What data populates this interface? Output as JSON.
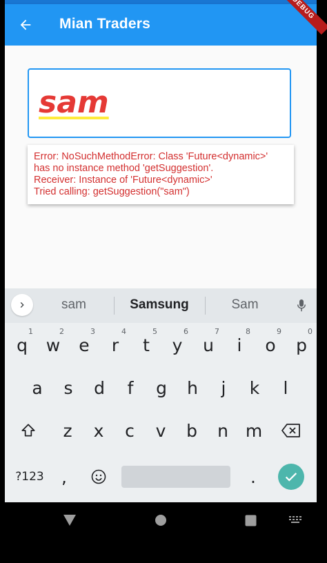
{
  "appbar": {
    "title": "Mian Traders",
    "debug_label": "DEBUG",
    "color": "#2196F3"
  },
  "input": {
    "value": "sam",
    "text_color": "#E53935"
  },
  "error": {
    "lines": [
      "Error: NoSuchMethodError: Class 'Future<dynamic>'",
      "has no instance method 'getSuggestion'.",
      "Receiver: Instance of 'Future<dynamic>'",
      "Tried calling: getSuggestion(\"sam\")"
    ],
    "color": "#D32F2F"
  },
  "keyboard": {
    "suggestions": [
      "sam",
      "Samsung",
      "Sam"
    ],
    "row1": [
      {
        "k": "q",
        "h": "1"
      },
      {
        "k": "w",
        "h": "2"
      },
      {
        "k": "e",
        "h": "3"
      },
      {
        "k": "r",
        "h": "4"
      },
      {
        "k": "t",
        "h": "5"
      },
      {
        "k": "y",
        "h": "6"
      },
      {
        "k": "u",
        "h": "7"
      },
      {
        "k": "i",
        "h": "8"
      },
      {
        "k": "o",
        "h": "9"
      },
      {
        "k": "p",
        "h": "0"
      }
    ],
    "row2": [
      "a",
      "s",
      "d",
      "f",
      "g",
      "h",
      "j",
      "k",
      "l"
    ],
    "row3": [
      "z",
      "x",
      "c",
      "v",
      "b",
      "n",
      "m"
    ],
    "symbols_label": "?123",
    "comma": ",",
    "period": ".",
    "enter_color": "#4DB6AC"
  },
  "icons": {
    "back": "arrow-left-icon",
    "expand": "chevron-right-icon",
    "mic": "microphone-icon",
    "shift": "shift-icon",
    "backspace": "backspace-icon",
    "emoji": "emoji-icon",
    "enter": "check-icon",
    "nav_back": "triangle-back-icon",
    "nav_home": "circle-home-icon",
    "nav_recents": "square-recents-icon",
    "nav_keyboard": "keyboard-switch-icon"
  }
}
